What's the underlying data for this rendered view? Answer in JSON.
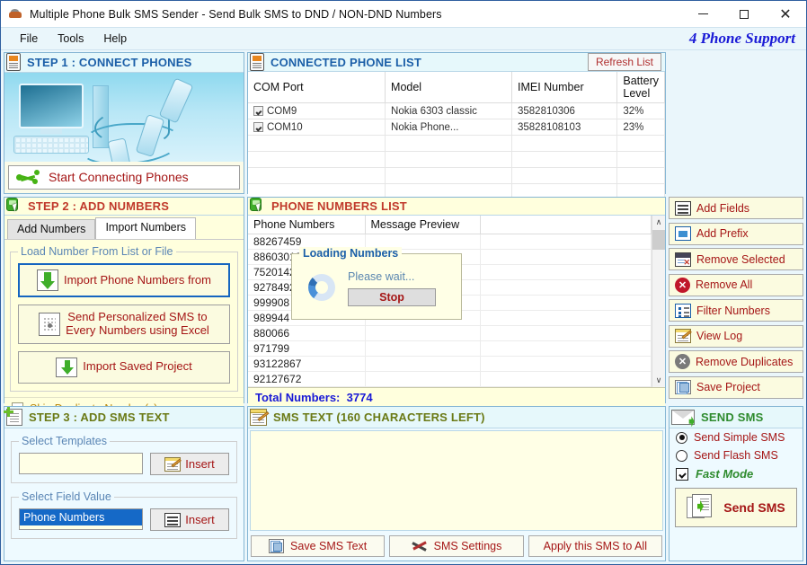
{
  "window": {
    "title": "Multiple Phone Bulk SMS Sender - Send Bulk SMS to DND / NON-DND Numbers",
    "minimize": "–",
    "maximize": "□",
    "close": "✕"
  },
  "menu": {
    "items": [
      "File",
      "Tools",
      "Help"
    ],
    "brand": "4 Phone Support"
  },
  "step1": {
    "header": "STEP 1 : CONNECT PHONES",
    "connect_button": "Start Connecting Phones"
  },
  "connected_phones": {
    "header": "CONNECTED PHONE LIST",
    "refresh_button": "Refresh List",
    "columns": [
      "COM  Port",
      "Model",
      "IMEI Number",
      "Battery Level"
    ],
    "rows": [
      {
        "port": "COM9",
        "checked": true,
        "model": "Nokia 6303 classic",
        "imei": "3582810306",
        "battery": "32%"
      },
      {
        "port": "COM10",
        "checked": true,
        "model": "Nokia Phone...",
        "imei": "35828108103",
        "battery": "23%"
      }
    ],
    "empty_rows": 5
  },
  "step2": {
    "header": "STEP 2 : ADD NUMBERS",
    "tabs": [
      {
        "label": "Add Numbers",
        "active": false
      },
      {
        "label": "Import Numbers",
        "active": true
      }
    ],
    "fieldset_legend": "Load Number From List or File",
    "buttons": [
      {
        "label": "Import Phone Numbers from",
        "selected": true
      },
      {
        "label": "Send Personalized SMS to\nEvery Numbers using Excel",
        "selected": false
      },
      {
        "label": "Import Saved Project",
        "selected": false
      }
    ],
    "skip_duplicates_label": "Skip Duplicate Number(s)",
    "skip_duplicates_checked": false
  },
  "phone_numbers": {
    "header": "PHONE NUMBERS LIST",
    "columns": [
      "Phone Numbers",
      "Message Preview",
      ""
    ],
    "rows": [
      "88267459",
      "88603018",
      "75201422",
      "92784925",
      "999908",
      "989944",
      "880066",
      "971799",
      "93122867",
      "92127672"
    ],
    "total_label": "Total Numbers:",
    "total_value": "3774",
    "scroll_up": "∧",
    "scroll_down": "∨"
  },
  "loading_dialog": {
    "title": "Loading Numbers",
    "message": "Please wait...",
    "stop_button": "Stop"
  },
  "number_tools": {
    "buttons": [
      {
        "label": "Add Fields",
        "icon": "add-fields-icon"
      },
      {
        "label": "Add Prefix",
        "icon": "add-prefix-icon"
      },
      {
        "label": "Remove Selected",
        "icon": "remove-selected-icon"
      },
      {
        "label": "Remove All",
        "icon": "remove-all-icon"
      },
      {
        "label": "Filter Numbers",
        "icon": "filter-numbers-icon"
      },
      {
        "label": "View Log",
        "icon": "view-log-icon"
      },
      {
        "label": "Remove Duplicates",
        "icon": "remove-duplicates-icon"
      },
      {
        "label": "Save Project",
        "icon": "save-project-icon"
      }
    ]
  },
  "step3": {
    "header": "STEP 3 : ADD SMS TEXT",
    "templates_legend": "Select Templates",
    "templates_value": "",
    "templates_insert": "Insert",
    "field_legend": "Select Field Value",
    "field_value": "Phone Numbers",
    "field_insert": "Insert"
  },
  "sms_text": {
    "header": "SMS TEXT (160 CHARACTERS LEFT)",
    "value": "",
    "buttons": [
      {
        "label": "Save SMS Text",
        "icon": "save-sms-icon"
      },
      {
        "label": "SMS Settings",
        "icon": "tools-icon"
      },
      {
        "label": "Apply this SMS to All",
        "icon": "none"
      }
    ]
  },
  "send_sms": {
    "header": "SEND SMS",
    "options": [
      {
        "label": "Send Simple SMS",
        "selected": true
      },
      {
        "label": "Send Flash SMS",
        "selected": false
      }
    ],
    "fast_mode_label": "Fast Mode",
    "fast_mode_checked": true,
    "send_button": "Send SMS"
  },
  "colors": {
    "accent_blue": "#1b5fa8",
    "brand_blue": "#1919d6",
    "button_red": "#a51616",
    "olive": "#6b7a16",
    "green": "#2e8b2e",
    "panel_yellow": "#fbfbe8",
    "border": "#86b6d4"
  }
}
